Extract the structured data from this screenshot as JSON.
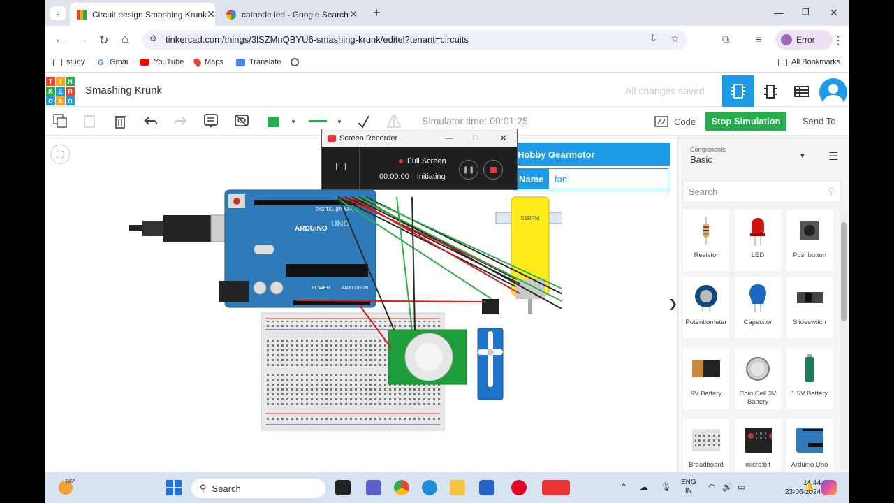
{
  "browser": {
    "tabs": [
      {
        "title": "Circuit design Smashing Krunk",
        "active": true
      },
      {
        "title": "cathode led - Google Search",
        "active": false
      }
    ],
    "url": "tinkercad.com/things/3lSZMnQBYU6-smashing-krunk/editel?tenant=circuits",
    "profile_label": "Error",
    "bookmarks": [
      "study",
      "Gmail",
      "YouTube",
      "Maps",
      "Translate"
    ],
    "all_bookmarks": "All Bookmarks"
  },
  "tinkercad": {
    "logo_letters": [
      "T",
      "I",
      "N",
      "K",
      "E",
      "R",
      "C",
      "A",
      "D"
    ],
    "project_title": "Smashing Krunk",
    "save_status": "All changes saved",
    "simulator_time": "Simulator time: 00:01:25",
    "code_label": "Code",
    "stop_label": "Stop Simulation",
    "send_label": "Send To"
  },
  "inspector": {
    "title": "Hobby Gearmotor",
    "name_label": "Name",
    "name_value": "fan"
  },
  "circuit_labels": {
    "arduino_brand": "ARDUINO",
    "arduino_model": "UNO",
    "digital": "DIGITAL (PWM~)",
    "power": "POWER",
    "analog": "ANALOG IN",
    "motor_rpm": "51RPM"
  },
  "components_panel": {
    "label": "Components",
    "selected": "Basic",
    "search_placeholder": "Search",
    "items": [
      "Resistor",
      "LED",
      "Pushbutton",
      "Potentiometer",
      "Capacitor",
      "Slideswitch",
      "9V Battery",
      "Coin Cell 3V Battery",
      "1.5V Battery",
      "Breadboard",
      "micro:bit",
      "Arduino Uno"
    ]
  },
  "recorder": {
    "title": "Screen Recorder",
    "mode": "Full Screen",
    "elapsed": "00:00:00",
    "status": "Initiating"
  },
  "taskbar": {
    "temperature": "96°",
    "search_label": "Search",
    "lang_line1": "ENG",
    "lang_line2": "IN",
    "time": "14:44",
    "date": "23-06-2024"
  },
  "colors": {
    "accent": "#1e9be6",
    "stop": "#27ae4c",
    "arduino": "#2f7ab9"
  }
}
